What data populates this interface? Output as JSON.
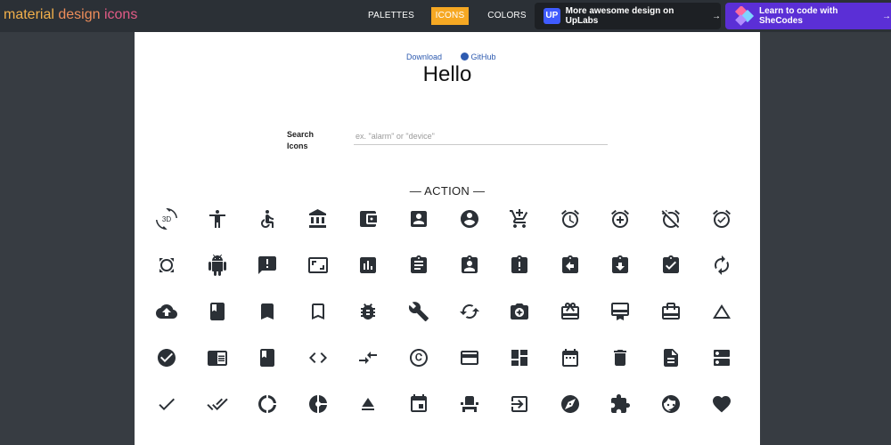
{
  "brand": {
    "word1": "material",
    "word2": "design",
    "word3": "icons"
  },
  "nav": {
    "palettes": "PALETTES",
    "icons": "ICONS",
    "colors": "COLORS"
  },
  "promos": {
    "uplabs": {
      "logo": "UP",
      "text": "More awesome design on UpLabs",
      "arrow": "→"
    },
    "shecodes": {
      "text": "Learn to code with SheCodes",
      "arrow": "→"
    }
  },
  "page": {
    "download_link": "Download",
    "github_link": "GitHub",
    "title": "Hello",
    "search_label": "Search Icons",
    "search_placeholder": "ex. \"alarm\" or \"device\"",
    "section_title": "— ACTION —"
  },
  "colors": {
    "accent": "#f6a823",
    "topbar": "#2b3036",
    "background": "#373c42",
    "icon": "#2b3036",
    "link": "#2e5bb0",
    "shecodes": "#5b2fd6"
  },
  "icons": [
    [
      "3d-rotation-icon",
      "accessibility-icon",
      "accessible-icon",
      "account-balance-icon",
      "account-balance-wallet-icon",
      "account-box-icon",
      "account-circle-icon",
      "add-shopping-cart-icon",
      "alarm-icon",
      "alarm-add-icon",
      "alarm-off-icon",
      "alarm-on-icon"
    ],
    [
      "all-out-icon",
      "android-icon",
      "announcement-icon",
      "aspect-ratio-icon",
      "assessment-icon",
      "assignment-icon",
      "assignment-ind-icon",
      "assignment-late-icon",
      "assignment-return-icon",
      "assignment-returned-icon",
      "assignment-turned-in-icon",
      "autorenew-icon"
    ],
    [
      "backup-icon",
      "book-icon",
      "bookmark-icon",
      "bookmark-border-icon",
      "bug-report-icon",
      "build-icon",
      "cached-icon",
      "camera-enhance-icon",
      "card-giftcard-icon",
      "card-membership-icon",
      "card-travel-icon",
      "change-history-icon"
    ],
    [
      "check-circle-icon",
      "chrome-reader-mode-icon",
      "class-icon",
      "code-icon",
      "compare-arrows-icon",
      "copyright-icon",
      "credit-card-icon",
      "dashboard-icon",
      "date-range-icon",
      "delete-icon",
      "description-icon",
      "dns-icon"
    ],
    [
      "done-icon",
      "done-all-icon",
      "donut-large-icon",
      "donut-small-icon",
      "eject-icon",
      "event-icon",
      "event-seat-icon",
      "exit-to-app-icon",
      "explore-icon",
      "extension-icon",
      "face-icon",
      "favorite-icon"
    ]
  ]
}
